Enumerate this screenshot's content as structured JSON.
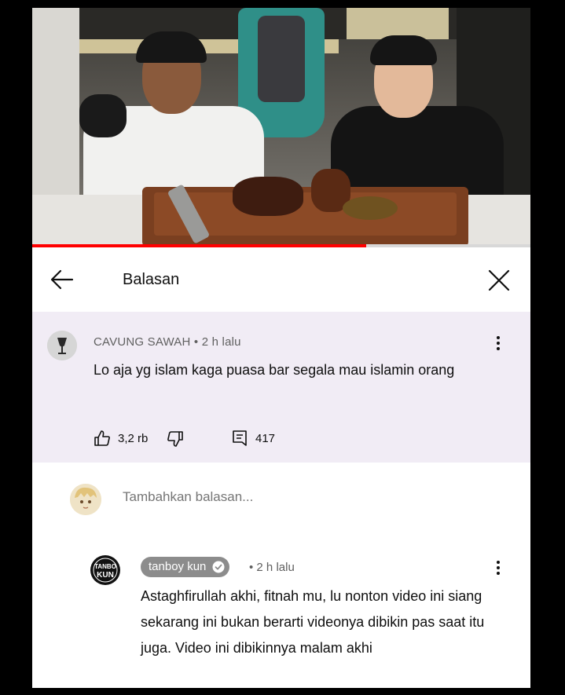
{
  "video": {
    "progress": 0.67
  },
  "header": {
    "title": "Balasan",
    "back_icon": "arrow-left-icon",
    "close_icon": "close-icon"
  },
  "parent_comment": {
    "author": "CAVUNG SAWAH",
    "time": "2 h lalu",
    "text": "Lo aja yg islam kaga puasa bar segala mau islamin orang",
    "likes": "3,2 rb",
    "replies": "417"
  },
  "add_reply": {
    "placeholder": "Tambahkan balasan..."
  },
  "reply": {
    "author": "tanboy kun",
    "time": "2 h lalu",
    "text": "Astaghfirullah akhi, fitnah mu, lu nonton video ini siang sekarang ini bukan berarti videonya dibikin pas saat itu juga. Video ini dibikinnya malam akhi",
    "avatar_text": "TANBO KUN"
  },
  "colors": {
    "accent": "#ff0000",
    "parent_bg": "#f1ecf5",
    "badge_bg": "#8c8c8c"
  }
}
